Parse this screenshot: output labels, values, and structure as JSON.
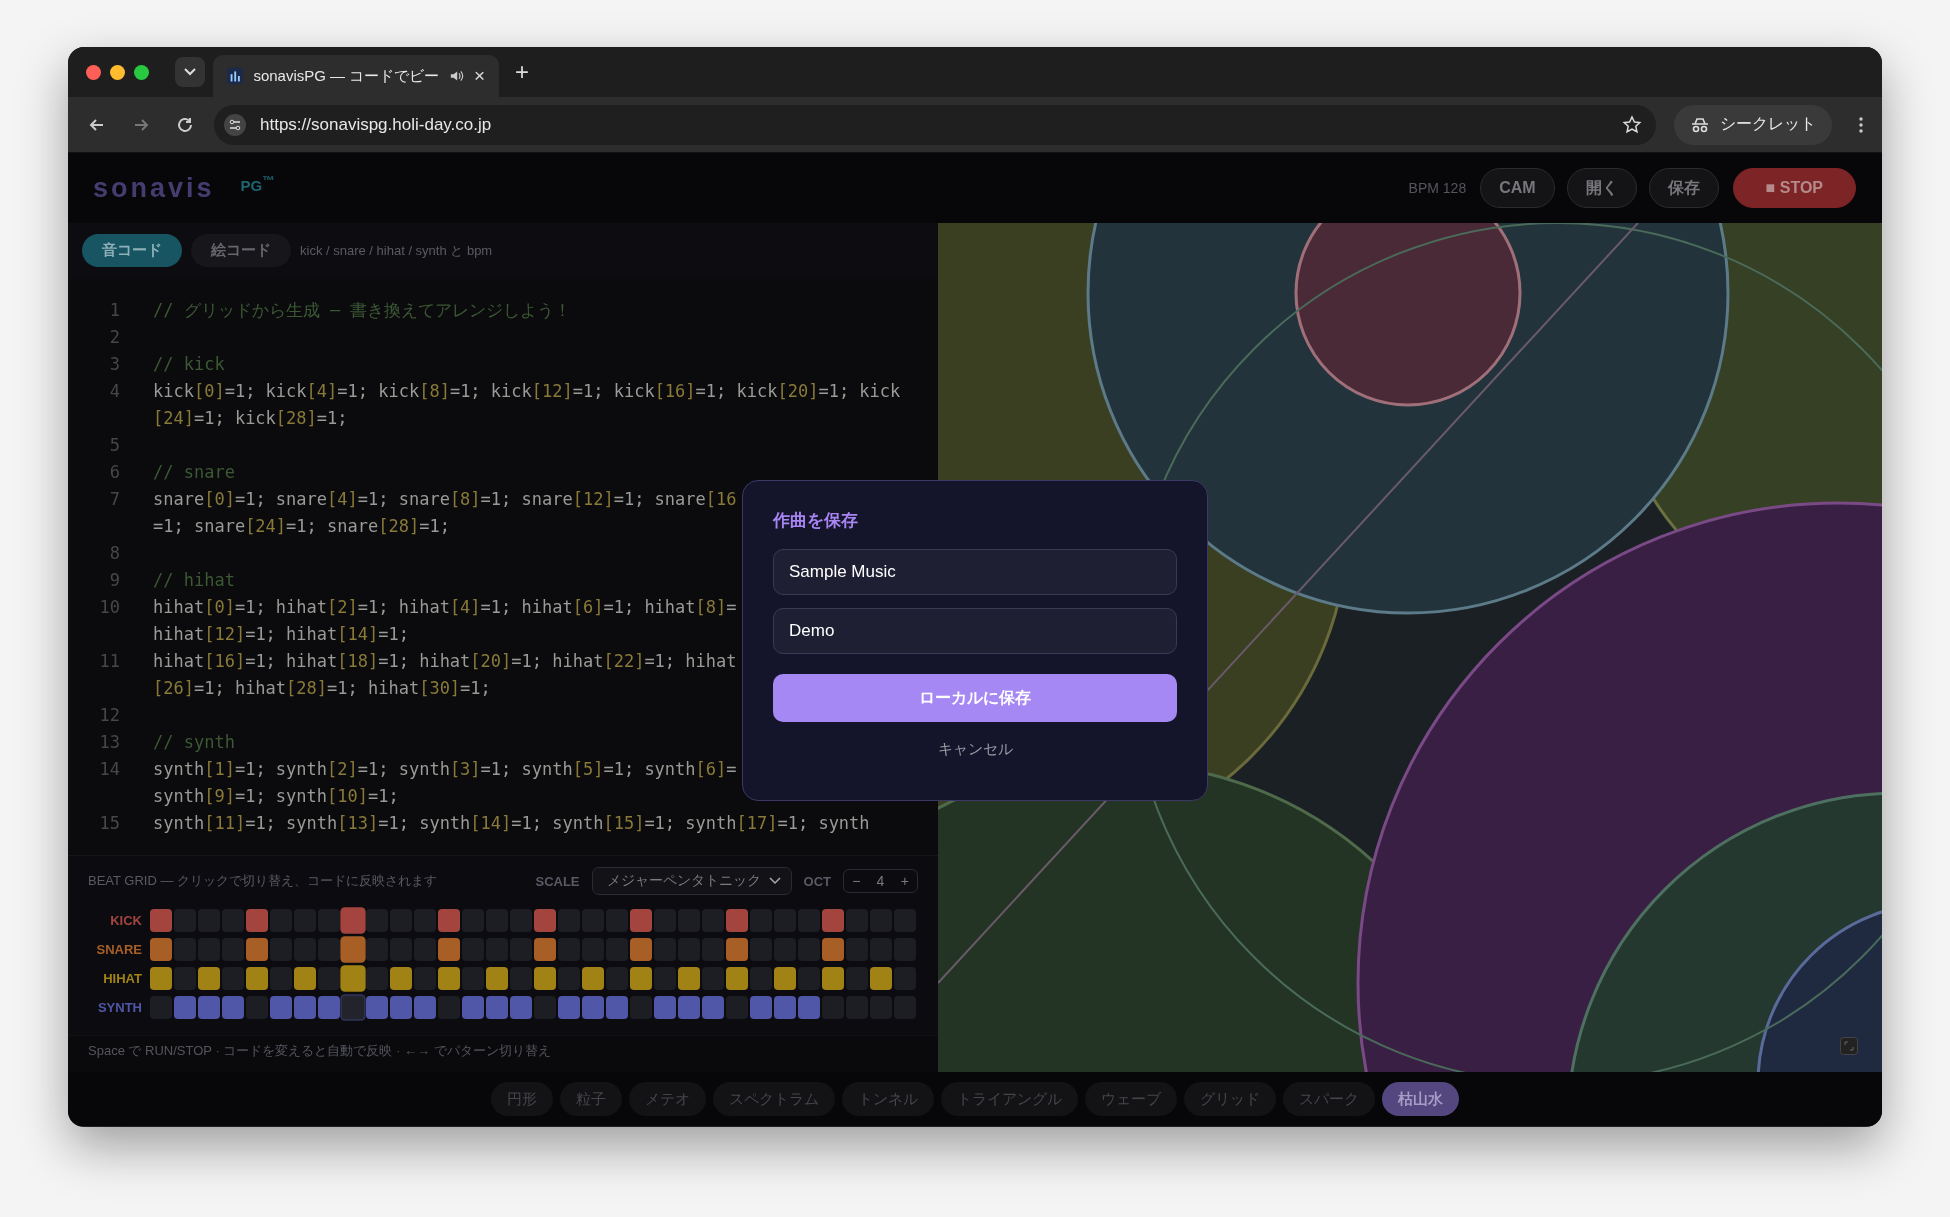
{
  "browser": {
    "tab": {
      "title": "sonavisPG — コードでビー",
      "close": "×"
    },
    "new_tab": "+",
    "url": "https://sonavispg.holi-day.co.jp",
    "profile": "シークレット"
  },
  "header": {
    "logo": "sonavis",
    "logo_suffix": "PG$^{™}$",
    "bpm": "BPM 128",
    "buttons": [
      {
        "label": "CAM",
        "kind": "normal"
      },
      {
        "label": "開く",
        "kind": "normal"
      },
      {
        "label": "保存",
        "kind": "normal"
      },
      {
        "label": "■ STOP",
        "kind": "danger"
      }
    ]
  },
  "code_tabs": [
    {
      "label": "音コード",
      "selected": true
    },
    {
      "label": "絵コード",
      "selected": false
    }
  ],
  "code_hint": "kick / snare / hihat / synth と bpm",
  "editor": {
    "lines": [
      {
        "number": "1",
        "kind": "comment",
        "rows": [
          "// グリッドから生成 — 書き換えてアレンジしよう！"
        ]
      },
      {
        "number": "2"
      },
      {
        "number": "3",
        "kind": "comment",
        "rows": [
          "// kick"
        ]
      },
      {
        "number": "4",
        "kind": "code",
        "rows": [
          "kick[0]=1; kick[4]=1; kick[8]=1; kick[12]=1; kick[16]=1; kick[20]=1; kick",
          "[24]=1; kick[28]=1;"
        ]
      },
      {
        "number": "5"
      },
      {
        "number": "6",
        "kind": "comment",
        "rows": [
          "// snare"
        ]
      },
      {
        "number": "7",
        "kind": "code",
        "rows": [
          "snare[0]=1; snare[4]=1; snare[8]=1; snare[12]=1; snare[16",
          "=1; snare[24]=1; snare[28]=1;"
        ]
      },
      {
        "number": "8"
      },
      {
        "number": "9",
        "kind": "comment",
        "rows": [
          "// hihat"
        ]
      },
      {
        "number": "10",
        "kind": "code",
        "rows": [
          "hihat[0]=1; hihat[2]=1; hihat[4]=1; hihat[6]=1; hihat[8]=",
          "hihat[12]=1; hihat[14]=1;"
        ]
      },
      {
        "number": "11",
        "kind": "code",
        "rows": [
          "hihat[16]=1; hihat[18]=1; hihat[20]=1; hihat[22]=1; hihat",
          "[26]=1; hihat[28]=1; hihat[30]=1;"
        ]
      },
      {
        "number": "12"
      },
      {
        "number": "13",
        "kind": "comment",
        "rows": [
          "// synth"
        ]
      },
      {
        "number": "14",
        "kind": "code",
        "rows": [
          "synth[1]=1; synth[2]=1; synth[3]=1; synth[5]=1; synth[6]=",
          "synth[9]=1; synth[10]=1;"
        ]
      },
      {
        "number": "15",
        "kind": "code",
        "rows": [
          "synth[11]=1; synth[13]=1; synth[14]=1; synth[15]=1; synth[17]=1; synth"
        ]
      }
    ]
  },
  "beat_grid": {
    "title": "BEAT GRID — クリックで切り替え、コードに反映されます",
    "scale_label": "SCALE",
    "scale_value": "メジャーペンタトニック",
    "oct_label": "OCT",
    "oct_minus": "−",
    "oct_value": "4",
    "oct_plus": "+",
    "current": [
      false,
      false,
      false,
      false,
      false,
      false,
      false,
      false,
      true,
      false,
      false,
      false,
      false,
      false,
      false,
      false,
      false,
      false,
      false,
      false,
      false,
      false,
      false,
      false,
      false,
      false,
      false,
      false,
      false,
      false,
      false,
      false
    ],
    "rows": [
      {
        "label": "KICK",
        "color": "#a3443f",
        "steps": [
          true,
          false,
          false,
          false,
          true,
          false,
          false,
          false,
          true,
          false,
          false,
          false,
          true,
          false,
          false,
          false,
          true,
          false,
          false,
          false,
          true,
          false,
          false,
          false,
          true,
          false,
          false,
          false,
          true,
          false,
          false,
          false
        ]
      },
      {
        "label": "SNARE",
        "color": "#a85f25",
        "steps": [
          true,
          false,
          false,
          false,
          true,
          false,
          false,
          false,
          true,
          false,
          false,
          false,
          true,
          false,
          false,
          false,
          true,
          false,
          false,
          false,
          true,
          false,
          false,
          false,
          true,
          false,
          false,
          false,
          true,
          false,
          false,
          false
        ]
      },
      {
        "label": "HIHAT",
        "color": "#a08215",
        "steps": [
          true,
          false,
          true,
          false,
          true,
          false,
          true,
          false,
          true,
          false,
          true,
          false,
          true,
          false,
          true,
          false,
          true,
          false,
          true,
          false,
          true,
          false,
          true,
          false,
          true,
          false,
          true,
          false,
          true,
          false,
          true,
          false
        ]
      },
      {
        "label": "SYNTH",
        "color": "#5157a8",
        "steps": [
          false,
          true,
          true,
          true,
          false,
          true,
          true,
          true,
          false,
          true,
          true,
          true,
          false,
          true,
          true,
          true,
          false,
          true,
          true,
          true,
          false,
          true,
          true,
          true,
          false,
          true,
          true,
          true,
          false,
          false,
          false,
          false
        ]
      }
    ]
  },
  "hint": "Space で RUN/STOP · コードを変えると自動で反映 · ←→ でパターン切り替え",
  "visual_modes": [
    {
      "label": "円形",
      "selected": false
    },
    {
      "label": "粒子",
      "selected": false
    },
    {
      "label": "メテオ",
      "selected": false
    },
    {
      "label": "スペクトラム",
      "selected": false
    },
    {
      "label": "トンネル",
      "selected": false
    },
    {
      "label": "トライアングル",
      "selected": false
    },
    {
      "label": "ウェーブ",
      "selected": false
    },
    {
      "label": "グリッド",
      "selected": false
    },
    {
      "label": "スパーク",
      "selected": false
    },
    {
      "label": "枯山水",
      "selected": true
    }
  ],
  "dialog": {
    "title": "作曲を保存",
    "fields": [
      {
        "value": "Sample Music"
      },
      {
        "value": "Demo"
      }
    ],
    "submit": "ローカルに保存",
    "cancel": "キャンセル"
  }
}
